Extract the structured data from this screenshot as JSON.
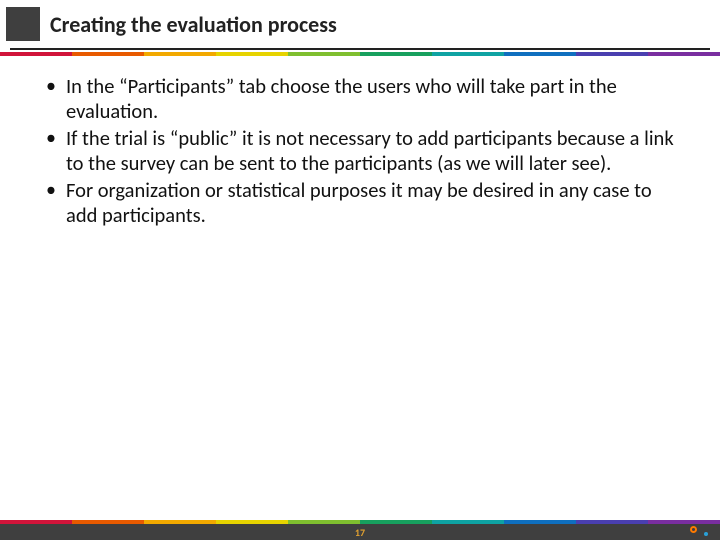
{
  "header": {
    "title": "Creating the evaluation process"
  },
  "bullets": [
    "In the “Participants” tab choose the users who will take part in the evaluation.",
    "If the trial is “public” it is not necessary to add participants because a link to the survey can be sent to the participants (as we will later see).",
    "For organization or statistical purposes it may be desired in any case to add participants."
  ],
  "footer": {
    "page_number": "17"
  }
}
